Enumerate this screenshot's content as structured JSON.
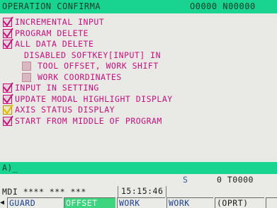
{
  "title": "OPERATION CONFIRMA",
  "numbers": "O0000 N00000",
  "settings": [
    {
      "label": "INCREMENTAL INPUT",
      "checkbox": "checked"
    },
    {
      "label": "PROGRAM DELETE",
      "checkbox": "checked"
    },
    {
      "label": "ALL DATA DELETE",
      "checkbox": "checked"
    },
    {
      "label": "DISABLED SOFTKEY[INPUT] IN",
      "checkbox": "none"
    },
    {
      "label": "TOOL OFFSET, WORK SHIFT",
      "checkbox": "unchecked"
    },
    {
      "label": "WORK COORDINATES",
      "checkbox": "unchecked"
    },
    {
      "label": "INPUT IN SETTING",
      "checkbox": "checked"
    },
    {
      "label": "UPDATE MODAL HIGHLIGHT DISPLAY",
      "checkbox": "checked"
    },
    {
      "label": "AXIS STATUS DISPLAY",
      "checkbox": "checked-yellow"
    },
    {
      "label": "START FROM MIDDLE OF PROGRAM",
      "checkbox": "checked"
    }
  ],
  "input_line": "A)_",
  "status": {
    "s_label": "S",
    "tool": "0 T0000",
    "mode": "MDI **** *** ***",
    "time": "15:15:46"
  },
  "softkeys": [
    "GUARD",
    "OFFSET",
    "WORK",
    "WORK",
    "(OPRT)"
  ],
  "colors": {
    "header": "#18d490",
    "label": "#c8107e",
    "check": "#c7107b",
    "focus_check": "#e0c000",
    "softkey_highlight": "#3dd67e"
  }
}
